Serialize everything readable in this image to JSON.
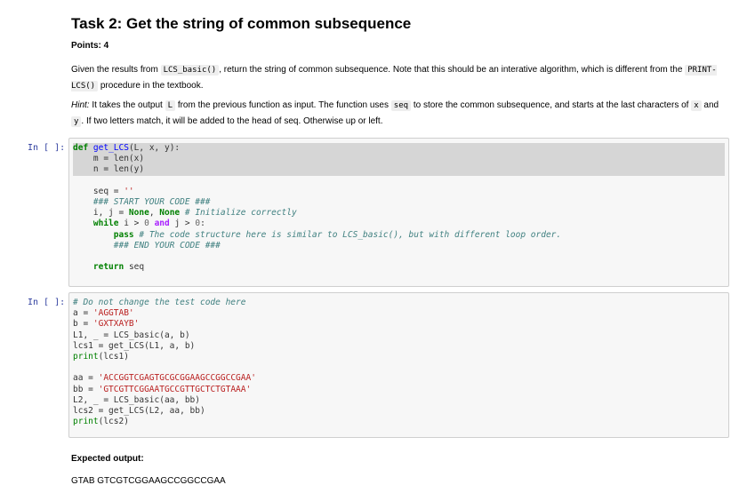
{
  "task": {
    "title": "Task 2: Get the string of common subsequence",
    "points": "Points: 4"
  },
  "desc1": {
    "t1": "Given the results from ",
    "c1": "LCS_basic()",
    "t2": ", return the string of common subsequence. Note that this should be an interative algorithm, which is different from the ",
    "c2": "PRINT-LCS()",
    "t3": " procedure in the textbook."
  },
  "desc2": {
    "hint": "Hint:",
    "t1": " It takes the output ",
    "c1": "L",
    "t2": " from the previous function as input. The function uses ",
    "c2": "seq",
    "t3": " to store the common subsequence, and starts at the last characters of ",
    "c3": "x",
    "t4": " and ",
    "c4": "y",
    "t5": ". If two letters match, it will be added to the head of seq. Otherwise up or left."
  },
  "cells": {
    "prompt1": "In [ ]:",
    "prompt2": "In [ ]:"
  },
  "code1": {
    "l1_def": "def",
    "l1_fn": "get_LCS",
    "l1_rest": "(L, x, y):",
    "l2": "    m = len(x)",
    "l3": "    n = len(y)",
    "l5a": "    seq = ",
    "l5s": "''",
    "l6": "    ### START YOUR CODE ###",
    "l7a": "    i, j = ",
    "l7b": "None",
    "l7c": ", ",
    "l7d": "None",
    "l7e": " ",
    "l7cm": "# Initialize correctly",
    "l8a": "    ",
    "l8w": "while",
    "l8b": " i > ",
    "l8n1": "0",
    "l8c": " ",
    "l8and": "and",
    "l8d": " j > ",
    "l8n2": "0",
    "l8e": ":",
    "l9a": "        ",
    "l9p": "pass",
    "l9b": " ",
    "l9cm": "# The code structure here is similar to LCS_basic(), but with different loop order.",
    "l10": "        ### END YOUR CODE ###",
    "l12a": "    ",
    "l12r": "return",
    "l12b": " seq"
  },
  "code2": {
    "l1": "# Do not change the test code here",
    "l2a": "a = ",
    "l2s": "'AGGTAB'",
    "l3a": "b = ",
    "l3s": "'GXTXAYB'",
    "l4": "L1, _ = LCS_basic(a, b)",
    "l5": "lcs1 = get_LCS(L1, a, b)",
    "l6p": "print",
    "l6r": "(lcs1)",
    "l8a": "aa = ",
    "l8s": "'ACCGGTCGAGTGCGCGGAAGCCGGCCGAA'",
    "l9a": "bb = ",
    "l9s": "'GTCGTTCGGAATGCCGTTGCTCTGTAAA'",
    "l10": "L2, _ = LCS_basic(aa, bb)",
    "l11": "lcs2 = get_LCS(L2, aa, bb)",
    "l12p": "print",
    "l12r": "(lcs2)"
  },
  "expected": {
    "label": "Expected output:",
    "value": "GTAB GTCGTCGGAAGCCGGCCGAA"
  }
}
